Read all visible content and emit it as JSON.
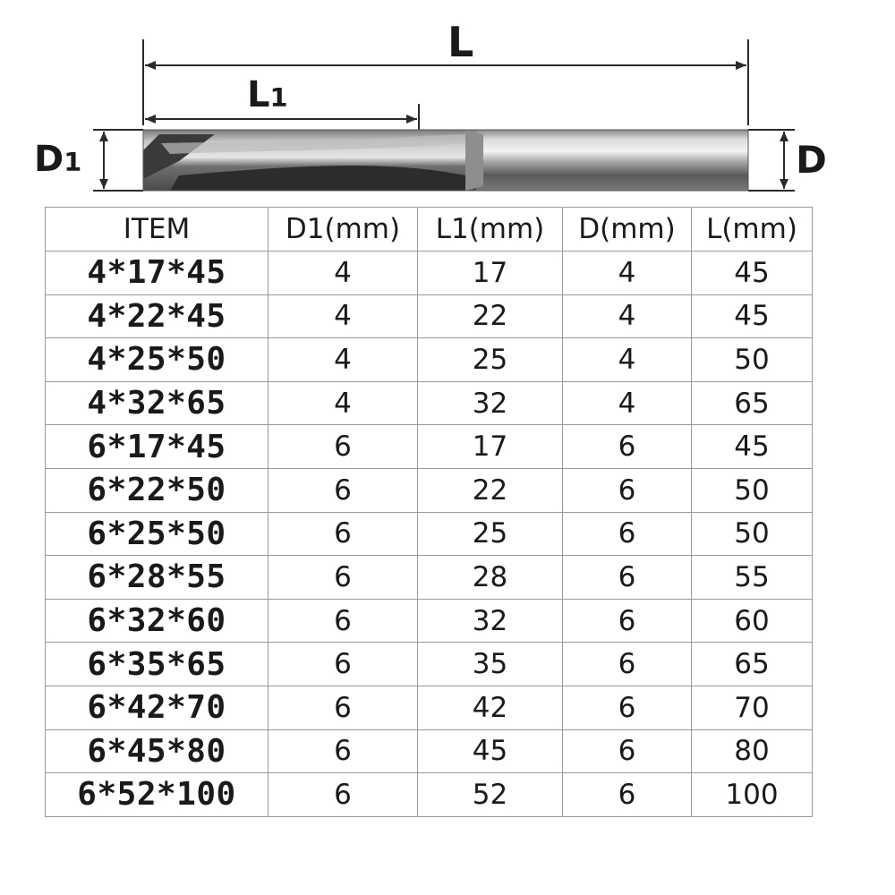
{
  "diagram": {
    "label_L": "L",
    "label_L1_main": "L",
    "label_L1_sub": "1",
    "label_D1_main": "D",
    "label_D1_sub": "1",
    "label_D": "D"
  },
  "table": {
    "headers": [
      "ITEM",
      "D1(mm)",
      "L1(mm)",
      "D(mm)",
      "L(mm)"
    ],
    "rows": [
      [
        "4*17*45",
        "4",
        "17",
        "4",
        "45"
      ],
      [
        "4*22*45",
        "4",
        "22",
        "4",
        "45"
      ],
      [
        "4*25*50",
        "4",
        "25",
        "4",
        "50"
      ],
      [
        "4*32*65",
        "4",
        "32",
        "4",
        "65"
      ],
      [
        "6*17*45",
        "6",
        "17",
        "6",
        "45"
      ],
      [
        "6*22*50",
        "6",
        "22",
        "6",
        "50"
      ],
      [
        "6*25*50",
        "6",
        "25",
        "6",
        "50"
      ],
      [
        "6*28*55",
        "6",
        "28",
        "6",
        "55"
      ],
      [
        "6*32*60",
        "6",
        "32",
        "6",
        "60"
      ],
      [
        "6*35*65",
        "6",
        "35",
        "6",
        "65"
      ],
      [
        "6*42*70",
        "6",
        "42",
        "6",
        "70"
      ],
      [
        "6*45*80",
        "6",
        "45",
        "6",
        "80"
      ],
      [
        "6*52*100",
        "6",
        "52",
        "6",
        "100"
      ]
    ]
  },
  "colors": {
    "line": "#2a2a2a",
    "border": "#9a9a9a",
    "text": "#1a1a1a"
  }
}
